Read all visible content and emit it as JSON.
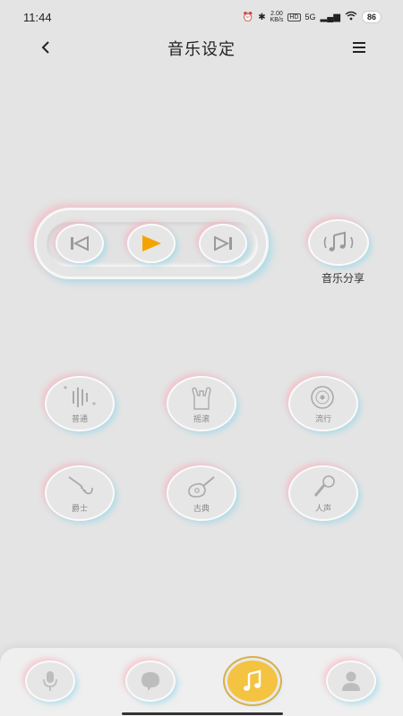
{
  "status_bar": {
    "time": "11:44",
    "speed_value": "2.00",
    "speed_unit": "KB/s",
    "hd": "HD",
    "signal": "5G",
    "battery": "86"
  },
  "header": {
    "title": "音乐设定"
  },
  "player": {
    "share_label": "音乐分享"
  },
  "equalizer": {
    "items": [
      {
        "label": "普通"
      },
      {
        "label": "摇滚"
      },
      {
        "label": "流行"
      },
      {
        "label": "爵士"
      },
      {
        "label": "古典"
      },
      {
        "label": "人声"
      }
    ]
  },
  "colors": {
    "accent": "#f5a300",
    "background": "#e4e4e4",
    "active_nav": "#f3c341"
  }
}
